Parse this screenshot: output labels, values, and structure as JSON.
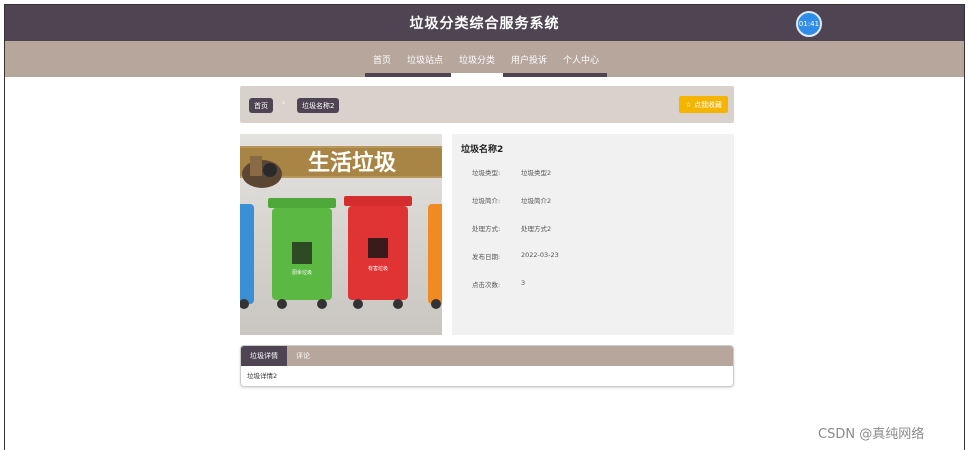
{
  "header": {
    "title": "垃圾分类综合服务系统",
    "clock_text": "01:41"
  },
  "nav": {
    "items": [
      {
        "label": "首页"
      },
      {
        "label": "垃圾站点"
      },
      {
        "label": "垃圾分类"
      },
      {
        "label": "用户投诉"
      },
      {
        "label": "个人中心"
      }
    ],
    "active_index": 2
  },
  "breadcrumb": {
    "home": "首页",
    "current": "垃圾名称2",
    "separator": "›"
  },
  "favorite_button": {
    "label": "☆ 点我收藏"
  },
  "detail": {
    "name": "垃圾名称2",
    "image": {
      "banner_text": "生活垃圾",
      "bin_labels": [
        "厨余垃圾",
        "有害垃圾"
      ]
    },
    "fields": [
      {
        "label": "垃圾类型:",
        "value": "垃圾类型2"
      },
      {
        "label": "垃圾简介:",
        "value": "垃圾简介2"
      },
      {
        "label": "处理方式:",
        "value": "处理方式2"
      },
      {
        "label": "发布日期:",
        "value": "2022-03-23"
      },
      {
        "label": "点击次数:",
        "value": "3"
      }
    ]
  },
  "tabs": {
    "items": [
      {
        "label": "垃圾详情"
      },
      {
        "label": "评论"
      }
    ],
    "content": "垃圾详情2"
  },
  "watermark": "CSDN @真纯网络",
  "colors": {
    "header": "#4e4452",
    "nav": "#b6a69c",
    "accent": "#f5b400"
  }
}
